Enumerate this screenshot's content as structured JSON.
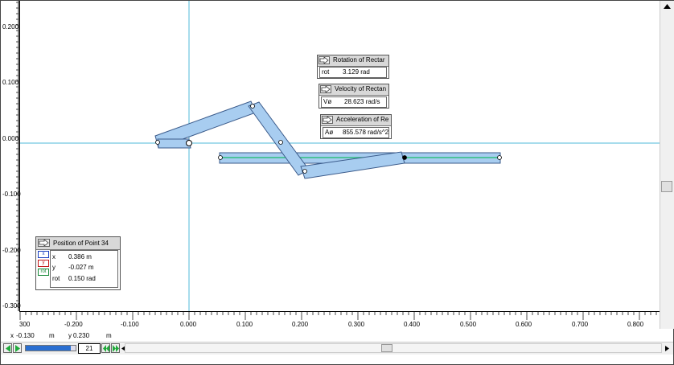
{
  "axes": {
    "y_ticks": [
      "0.200",
      "0.100",
      "0.000",
      "-0.100",
      "-0.200",
      "-0.300"
    ],
    "x_ticks": [
      "300",
      "-0.200",
      "-0.100",
      "0.000",
      "0.100",
      "0.200",
      "0.300",
      "0.400",
      "0.500",
      "0.600",
      "0.700",
      "0.800"
    ]
  },
  "meters": {
    "rotation": {
      "title": "Rotation of Rectar",
      "label": "rot",
      "value": "3.129 rad"
    },
    "velocity": {
      "title": "Velocity of Rectanı",
      "label": "Vø",
      "value": "28.623 rad/s"
    },
    "acceleration": {
      "title": "Acceleration of Re",
      "label": "Aø",
      "value": "855.578 rad/s^2"
    }
  },
  "position_meter": {
    "title": "Position of Point 34",
    "x_label": "x",
    "x_value": "0.386 m",
    "y_label": "y",
    "y_value": "-0.027 m",
    "rot_label": "rot",
    "rot_value": "0.150 rad",
    "icon_x": "x",
    "icon_y": "y",
    "icon_rot": "rot"
  },
  "status": {
    "x_label": "x",
    "x_value": "-0.130",
    "x_unit": "m",
    "y_label": "y",
    "y_value": "0.230",
    "y_unit": "m"
  },
  "controls": {
    "frame": "21",
    "progress": 0.9
  },
  "colors": {
    "axis": "#4fb8d8",
    "link_fill": "#a8cdf0",
    "link_stroke": "#3a5a8a",
    "slider_line": "#2fbf7f"
  }
}
